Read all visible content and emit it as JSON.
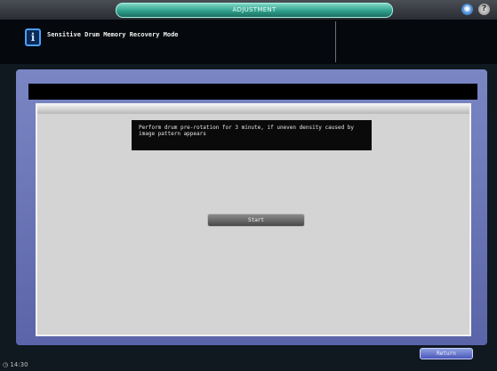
{
  "topbar": {
    "mode_label": "ADJUSTMENT",
    "icon_left": "settings-globe-icon",
    "icon_right": "help-icon",
    "help_glyph": "?"
  },
  "header": {
    "icon": "info-icon",
    "info_glyph": "i",
    "title": "Sensitive Drum Memory Recovery Mode"
  },
  "main": {
    "message": "Perform drum pre-rotation for 3 minute, if uneven density caused by image pattern appears",
    "start_label": "Start"
  },
  "footer": {
    "return_label": "Return",
    "clock": "14:30",
    "clock_icon": "clock-icon"
  },
  "colors": {
    "accent": "#2f9f8c",
    "frame": "#6a74b6",
    "panel": "#d4d4d4"
  }
}
